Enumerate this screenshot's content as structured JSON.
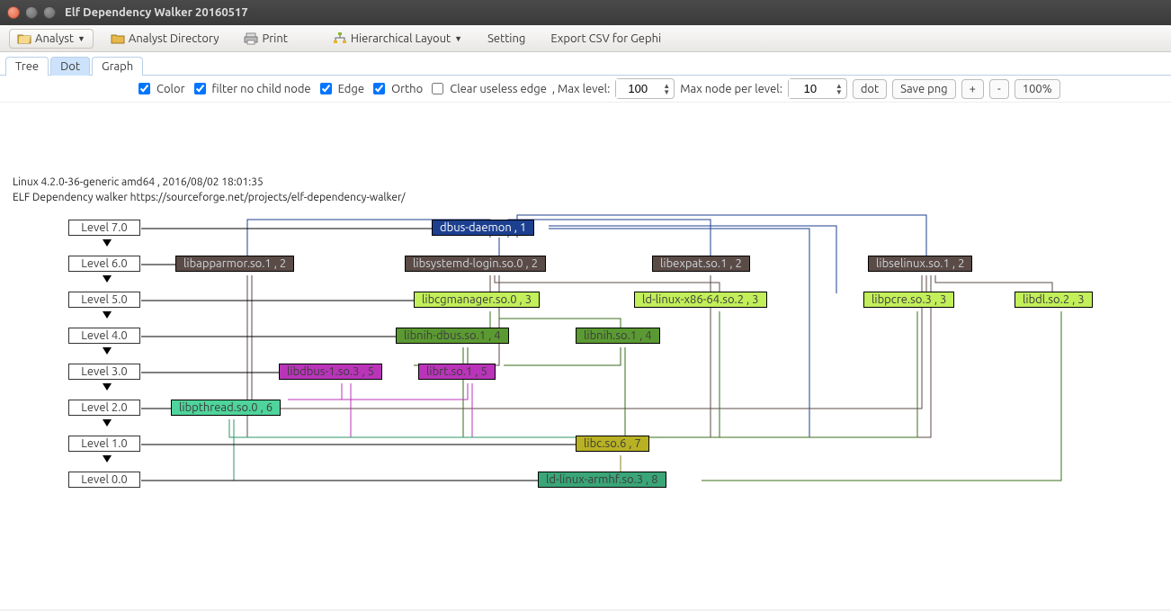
{
  "window": {
    "title": "Elf Dependency Walker 20160517"
  },
  "toolbar": {
    "analyst": "Analyst",
    "analyst_dir": "Analyst Directory",
    "print": "Print",
    "layout": "Hierarchical Layout",
    "setting": "Setting",
    "export": "Export CSV for Gephi"
  },
  "tabs": {
    "tree": "Tree",
    "dot": "Dot",
    "graph": "Graph",
    "active": "dot"
  },
  "options": {
    "color": "Color",
    "filter_no_child": "filter no child node",
    "edge": "Edge",
    "ortho": "Ortho",
    "clear_useless": "Clear useless edge",
    "max_level_label": ", Max level:",
    "max_level_value": "100",
    "max_node_label": "Max node per level:",
    "max_node_value": "10",
    "dot_btn": "dot",
    "save_png_btn": "Save png",
    "plus": "+",
    "minus": "-",
    "zoom": "100%"
  },
  "info": {
    "line1": "Linux 4.2.0-36-generic amd64 , 2016/08/02 18:01:35",
    "line2": "ELF Dependency walker https://sourceforge.net/projects/elf-dependency-walker/"
  },
  "levels": [
    "Level 7.0",
    "Level 6.0",
    "Level 5.0",
    "Level 4.0",
    "Level 3.0",
    "Level 2.0",
    "Level 1.0",
    "Level 0.0"
  ],
  "chart_data": {
    "type": "diagram",
    "nodes": [
      {
        "id": "dbus-daemon",
        "label": "dbus-daemon , 1",
        "level": 7,
        "color": "#1c3f8f",
        "text": "#ffffff"
      },
      {
        "id": "libapparmor",
        "label": "libapparmor.so.1 , 2",
        "level": 6,
        "color": "#5b4b47",
        "text": "#cfd4d8"
      },
      {
        "id": "libsystemd",
        "label": "libsystemd-login.so.0 , 2",
        "level": 6,
        "color": "#5b4b47",
        "text": "#cfd4d8"
      },
      {
        "id": "libexpat",
        "label": "libexpat.so.1 , 2",
        "level": 6,
        "color": "#5b4b47",
        "text": "#cfd4d8"
      },
      {
        "id": "libselinux",
        "label": "libselinux.so.1 , 2",
        "level": 6,
        "color": "#5b4b47",
        "text": "#cfd4d8"
      },
      {
        "id": "libcgmanager",
        "label": "libcgmanager.so.0 , 3",
        "level": 5,
        "color": "#c2ef5a",
        "text": "#000"
      },
      {
        "id": "ld-linux-x86-64",
        "label": "ld-linux-x86-64.so.2 , 3",
        "level": 5,
        "color": "#c2ef5a",
        "text": "#000"
      },
      {
        "id": "libpcre",
        "label": "libpcre.so.3 , 3",
        "level": 5,
        "color": "#c2ef5a",
        "text": "#000"
      },
      {
        "id": "libdl",
        "label": "libdl.so.2 , 3",
        "level": 5,
        "color": "#c2ef5a",
        "text": "#000"
      },
      {
        "id": "libnih-dbus",
        "label": "libnih-dbus.so.1 , 4",
        "level": 4,
        "color": "#5b9a32",
        "text": "#000"
      },
      {
        "id": "libnih",
        "label": "libnih.so.1 , 4",
        "level": 4,
        "color": "#5b9a32",
        "text": "#000"
      },
      {
        "id": "libdbus-1",
        "label": "libdbus-1.so.3 , 5",
        "level": 3,
        "color": "#b934b9",
        "text": "#000"
      },
      {
        "id": "librt",
        "label": "librt.so.1 , 5",
        "level": 3,
        "color": "#b934b9",
        "text": "#000"
      },
      {
        "id": "libpthread",
        "label": "libpthread.so.0 , 6",
        "level": 2,
        "color": "#4fd49b",
        "text": "#000"
      },
      {
        "id": "libc",
        "label": "libc.so.6 , 7",
        "level": 1,
        "color": "#b8b124",
        "text": "#000"
      },
      {
        "id": "ld-linux-armhf",
        "label": "ld-linux-armhf.so.3 , 8",
        "level": 0,
        "color": "#3aa577",
        "text": "#000"
      }
    ]
  }
}
